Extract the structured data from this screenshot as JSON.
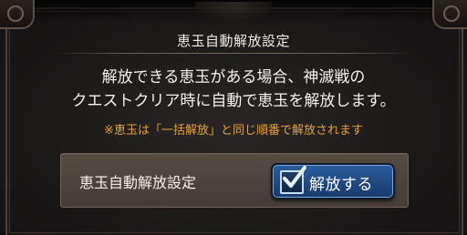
{
  "dialog": {
    "title": "恵玉自動解放設定",
    "description_line1": "解放できる恵玉がある場合、神滅戦の",
    "description_line2": "クエストクリア時に自動で恵玉を解放します。",
    "note": "※恵玉は「一括解放」と同じ順番で解放されます",
    "setting": {
      "label": "恵玉自動解放設定",
      "toggle_label": "解放する",
      "checked": true
    }
  },
  "colors": {
    "note": "#e0a23a",
    "toggle_bg": "#2a5d9d",
    "panel_bg": "#1c1919",
    "row_bg": "#554c43"
  },
  "icons": {
    "checkbox": "checkmark-icon"
  }
}
